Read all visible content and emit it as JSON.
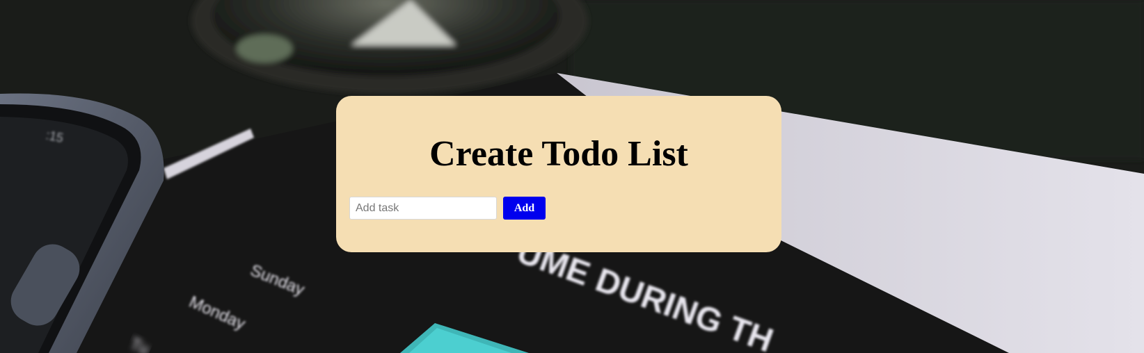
{
  "card": {
    "title": "Create Todo List",
    "input_placeholder": "Add task",
    "input_value": "",
    "add_label": "Add"
  },
  "background": {
    "description_words": {
      "sunday": "Sunday",
      "monday": "Monday",
      "heading_fragment": "UME DURING TH"
    }
  },
  "colors": {
    "card_background": "#f5deb3",
    "button_background": "#0000ee",
    "button_text": "#ffffff"
  }
}
